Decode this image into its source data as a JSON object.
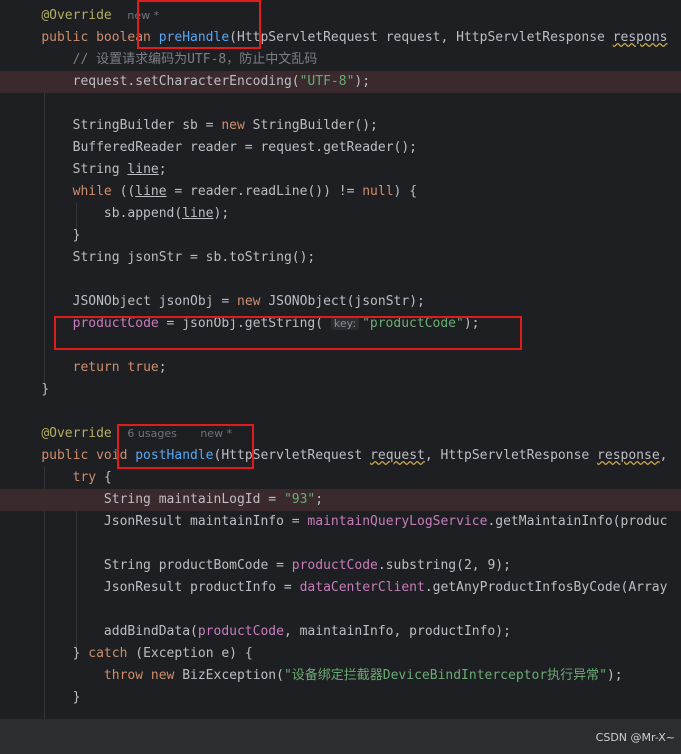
{
  "palette": {
    "default": "#bcbec4",
    "keyword": "#cf8e6d",
    "string": "#6aab73",
    "annotation": "#b3ae60",
    "method_decl": "#56a8f5",
    "field": "#c77dbb",
    "comment": "#7a7e85",
    "hint": "#6f737a",
    "highlight_row": "#3a2a2d",
    "red_box": "#e01c1c"
  },
  "editor": {
    "lines": [
      {
        "hl": false,
        "t": [
          [
            "    ",
            "default"
          ],
          [
            "@Override",
            "annotation"
          ],
          [
            "  ",
            "default"
          ],
          [
            "new *",
            "hint"
          ]
        ]
      },
      {
        "hl": false,
        "t": [
          [
            "    ",
            "default"
          ],
          [
            "public boolean ",
            "keyword"
          ],
          [
            "preHandle",
            "method_decl"
          ],
          [
            "(HttpServletRequest request, HttpServletResponse ",
            "default"
          ],
          [
            "respons",
            "default",
            "wavy"
          ]
        ]
      },
      {
        "hl": false,
        "t": [
          [
            "        ",
            "default"
          ],
          [
            "// 设置请求编码为UTF-8，防止中文乱码",
            "comment"
          ]
        ]
      },
      {
        "hl": true,
        "t": [
          [
            "        ",
            "default"
          ],
          [
            "request.setCharacterEncoding(",
            "default"
          ],
          [
            "\"UTF-8\"",
            "string"
          ],
          [
            ");",
            "default"
          ]
        ]
      },
      {
        "hl": false,
        "t": []
      },
      {
        "hl": false,
        "t": [
          [
            "        ",
            "default"
          ],
          [
            "StringBuilder sb = ",
            "default"
          ],
          [
            "new ",
            "keyword"
          ],
          [
            "StringBuilder();",
            "default"
          ]
        ]
      },
      {
        "hl": false,
        "t": [
          [
            "        ",
            "default"
          ],
          [
            "BufferedReader reader = request.getReader();",
            "default"
          ]
        ]
      },
      {
        "hl": false,
        "t": [
          [
            "        ",
            "default"
          ],
          [
            "String ",
            "default"
          ],
          [
            "line",
            "default",
            "under"
          ],
          [
            ";",
            "default"
          ]
        ]
      },
      {
        "hl": false,
        "t": [
          [
            "        ",
            "default"
          ],
          [
            "while ",
            "keyword"
          ],
          [
            "((",
            "default"
          ],
          [
            "line",
            "default",
            "under"
          ],
          [
            " = reader.readLine()) != ",
            "default"
          ],
          [
            "null",
            "keyword"
          ],
          [
            ") {",
            "default"
          ]
        ]
      },
      {
        "hl": false,
        "t": [
          [
            "            ",
            "default"
          ],
          [
            "sb.append(",
            "default"
          ],
          [
            "line",
            "default",
            "under"
          ],
          [
            ");",
            "default"
          ]
        ]
      },
      {
        "hl": false,
        "t": [
          [
            "        ",
            "default"
          ],
          [
            "}",
            "default"
          ]
        ]
      },
      {
        "hl": false,
        "t": [
          [
            "        ",
            "default"
          ],
          [
            "String jsonStr = sb.toString();",
            "default"
          ]
        ]
      },
      {
        "hl": false,
        "t": []
      },
      {
        "hl": false,
        "t": [
          [
            "        ",
            "default"
          ],
          [
            "JSONObject jsonObj = ",
            "default"
          ],
          [
            "new ",
            "keyword"
          ],
          [
            "JSONObject(jsonStr);",
            "default"
          ]
        ]
      },
      {
        "hl": false,
        "t": [
          [
            "        ",
            "default"
          ],
          [
            "productCode",
            "field"
          ],
          [
            " = jsonObj.getString( ",
            "default"
          ],
          [
            "key:",
            "param"
          ],
          [
            "\"productCode\"",
            "string"
          ],
          [
            ");",
            "default"
          ]
        ]
      },
      {
        "hl": false,
        "t": []
      },
      {
        "hl": false,
        "t": [
          [
            "        ",
            "default"
          ],
          [
            "return true",
            "keyword"
          ],
          [
            ";",
            "default"
          ]
        ]
      },
      {
        "hl": false,
        "t": [
          [
            "    ",
            "default"
          ],
          [
            "}",
            "default"
          ]
        ]
      },
      {
        "hl": false,
        "t": []
      },
      {
        "hl": false,
        "t": [
          [
            "    ",
            "default"
          ],
          [
            "@Override",
            "annotation"
          ],
          [
            "  ",
            "default"
          ],
          [
            "6 usages",
            "hint"
          ],
          [
            "   ",
            "default"
          ],
          [
            "new *",
            "hint"
          ]
        ]
      },
      {
        "hl": false,
        "t": [
          [
            "    ",
            "default"
          ],
          [
            "public void ",
            "keyword"
          ],
          [
            "postHandle",
            "method_decl"
          ],
          [
            "(HttpServletRequest ",
            "default"
          ],
          [
            "request",
            "default",
            "wavy"
          ],
          [
            ", HttpServletResponse ",
            "default"
          ],
          [
            "response",
            "default",
            "wavy"
          ],
          [
            ",",
            "default"
          ]
        ]
      },
      {
        "hl": false,
        "t": [
          [
            "        ",
            "default"
          ],
          [
            "try ",
            "keyword"
          ],
          [
            "{",
            "default"
          ]
        ]
      },
      {
        "hl": true,
        "t": [
          [
            "            ",
            "default"
          ],
          [
            "String maintainLogId = ",
            "default"
          ],
          [
            "\"93\"",
            "string"
          ],
          [
            ";",
            "default"
          ]
        ]
      },
      {
        "hl": false,
        "t": [
          [
            "            ",
            "default"
          ],
          [
            "JsonResult maintainInfo = ",
            "default"
          ],
          [
            "maintainQueryLogService",
            "field"
          ],
          [
            ".getMaintainInfo(produc",
            "default"
          ]
        ]
      },
      {
        "hl": false,
        "t": []
      },
      {
        "hl": false,
        "t": [
          [
            "            ",
            "default"
          ],
          [
            "String productBomCode = ",
            "default"
          ],
          [
            "productCode",
            "field"
          ],
          [
            ".substring(",
            "default"
          ],
          [
            "2",
            "default"
          ],
          [
            ", ",
            "default"
          ],
          [
            "9",
            "default"
          ],
          [
            ");",
            "default"
          ]
        ]
      },
      {
        "hl": false,
        "t": [
          [
            "            ",
            "default"
          ],
          [
            "JsonResult productInfo = ",
            "default"
          ],
          [
            "dataCenterClient",
            "field"
          ],
          [
            ".getAnyProductInfosByCode(Array",
            "default"
          ]
        ]
      },
      {
        "hl": false,
        "t": []
      },
      {
        "hl": false,
        "t": [
          [
            "            ",
            "default"
          ],
          [
            "addBindData(",
            "default"
          ],
          [
            "productCode",
            "field"
          ],
          [
            ", maintainInfo, productInfo);",
            "default"
          ]
        ]
      },
      {
        "hl": false,
        "t": [
          [
            "        ",
            "default"
          ],
          [
            "} ",
            "default"
          ],
          [
            "catch ",
            "keyword"
          ],
          [
            "(Exception e) {",
            "default"
          ]
        ]
      },
      {
        "hl": false,
        "t": [
          [
            "            ",
            "default"
          ],
          [
            "throw new ",
            "keyword"
          ],
          [
            "BizException(",
            "default"
          ],
          [
            "\"设备绑定拦截器DeviceBindInterceptor执行异常\"",
            "string"
          ],
          [
            ");",
            "default"
          ]
        ]
      },
      {
        "hl": false,
        "t": [
          [
            "        ",
            "default"
          ],
          [
            "}",
            "default"
          ]
        ]
      }
    ]
  },
  "footer": {
    "watermark": "CSDN @Mr-X~"
  }
}
